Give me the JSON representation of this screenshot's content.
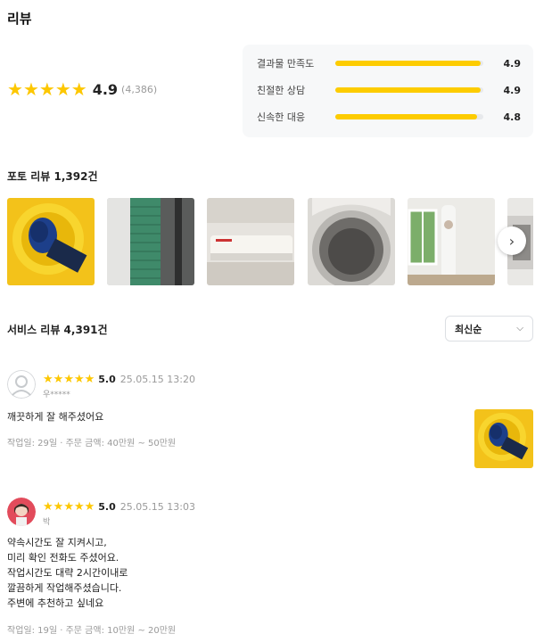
{
  "header": {
    "title": "리뷰"
  },
  "summary": {
    "score": "4.9",
    "count": "(4,386)",
    "star_rating": 5,
    "breakdown": [
      {
        "label": "결과물 만족도",
        "value": "4.9",
        "fill": 0.98
      },
      {
        "label": "친절한 상담",
        "value": "4.9",
        "fill": 0.98
      },
      {
        "label": "신속한 대응",
        "value": "4.8",
        "fill": 0.96
      }
    ]
  },
  "photo_reviews": {
    "title": "포토 리뷰 1,392건",
    "photos": [
      "yellow-drain-photo",
      "green-coil-photo",
      "wall-aircon-photo",
      "washer-drum-photo",
      "stand-aircon-photo",
      "window-photo"
    ],
    "next_icon": "chevron-right-icon"
  },
  "service_reviews": {
    "title": "서비스 리뷰 4,391건",
    "sort": {
      "selected": "최신순",
      "icon": "chevron-down-icon"
    }
  },
  "reviews": [
    {
      "rating": 5,
      "score": "5.0",
      "date": "25.05.15 13:20",
      "reviewer": "우*****",
      "body": "깨끗하게 잘 해주셨어요",
      "meta": "작업일: 29일 · 주문 금액: 40만원 ~ 50만원",
      "has_photo": true
    },
    {
      "rating": 5,
      "score": "5.0",
      "date": "25.05.15 13:03",
      "reviewer": "박",
      "body_lines": [
        "약속시간도 잘 지켜시고,",
        "미리 확인 전화도 주셨어요.",
        "작업시간도 대략 2시간이내로",
        "깔끔하게 작업해주셨습니다.",
        "주변에 추천하고 싶네요"
      ],
      "meta": "작업일: 19일 · 주문 금액: 10만원 ~ 20만원",
      "has_photo": false
    }
  ],
  "colors": {
    "star": "#fdc700",
    "bar": "#fdcc00",
    "muted": "#9a9a9a"
  }
}
